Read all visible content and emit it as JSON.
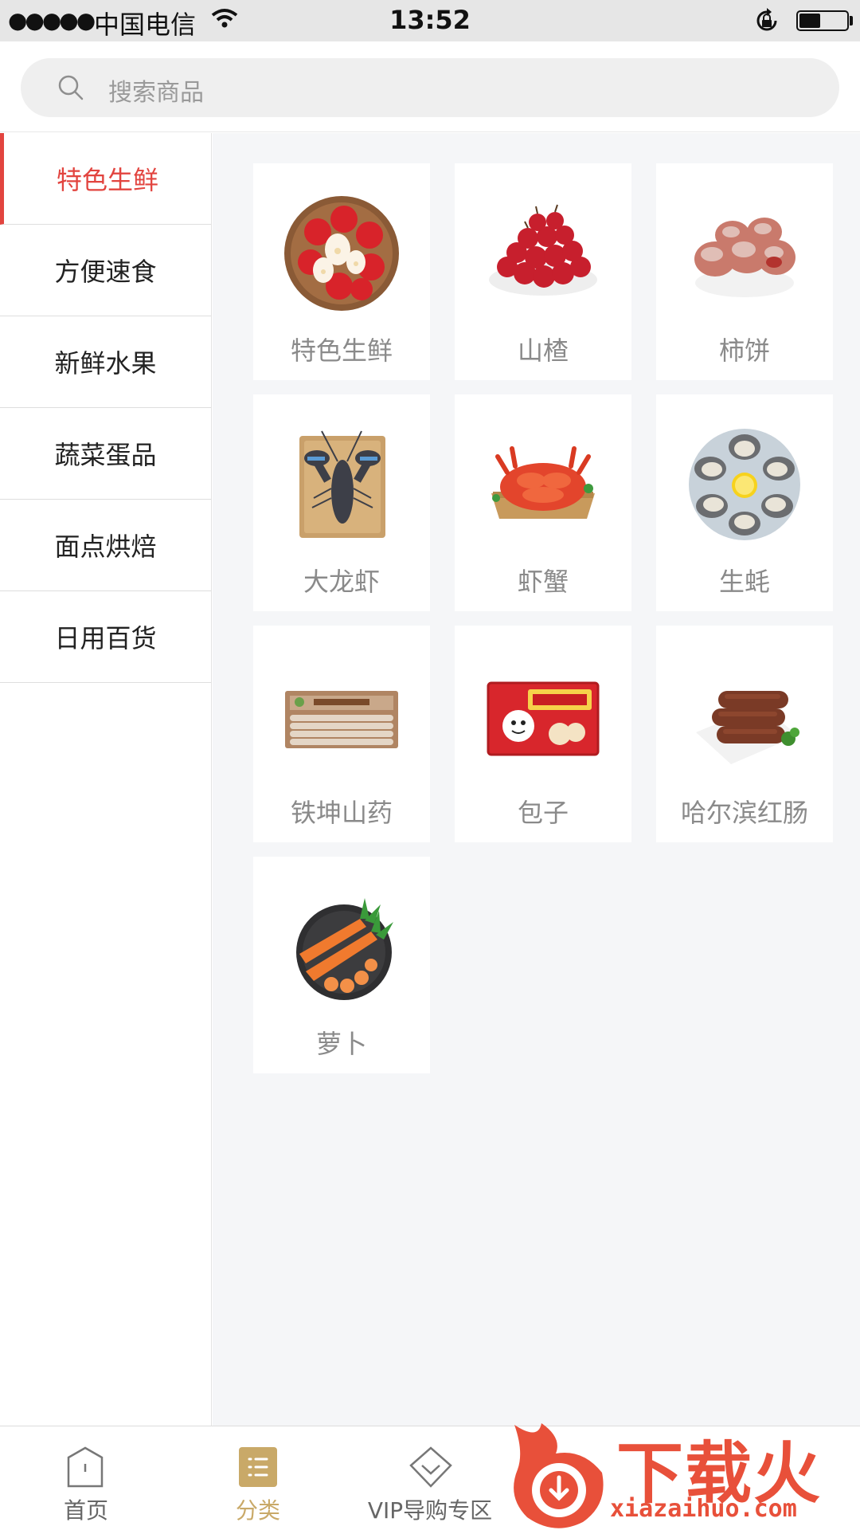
{
  "status_bar": {
    "signal": "●●●●●",
    "carrier": "中国电信",
    "time": "13:52",
    "battery_level": 0.45
  },
  "search": {
    "placeholder": "搜索商品"
  },
  "sidebar": {
    "items": [
      {
        "label": "特色生鲜",
        "active": true
      },
      {
        "label": "方便速食",
        "active": false
      },
      {
        "label": "新鲜水果",
        "active": false
      },
      {
        "label": "蔬菜蛋品",
        "active": false
      },
      {
        "label": "面点烘焙",
        "active": false
      },
      {
        "label": "日用百货",
        "active": false
      }
    ]
  },
  "grid": {
    "items": [
      {
        "label": "特色生鲜",
        "icon": "wax-apple-bowl-image"
      },
      {
        "label": "山楂",
        "icon": "hawthorn-bowl-image"
      },
      {
        "label": "柿饼",
        "icon": "dried-persimmon-image"
      },
      {
        "label": "大龙虾",
        "icon": "lobster-image"
      },
      {
        "label": "虾蟹",
        "icon": "crab-image"
      },
      {
        "label": "生蚝",
        "icon": "oyster-plate-image"
      },
      {
        "label": "铁坤山药",
        "icon": "yam-box-image"
      },
      {
        "label": "包子",
        "icon": "bun-package-image"
      },
      {
        "label": "哈尔滨红肠",
        "icon": "sausage-plate-image"
      },
      {
        "label": "萝卜",
        "icon": "carrot-bowl-image"
      }
    ]
  },
  "tab_bar": {
    "tabs": [
      {
        "label": "首页",
        "icon": "home-icon",
        "active": false
      },
      {
        "label": "分类",
        "icon": "category-icon",
        "active": true
      },
      {
        "label": "VIP导购专区",
        "icon": "diamond-icon",
        "active": false
      }
    ]
  },
  "watermark": {
    "text": "下载火",
    "url": "xiazaihuo.com"
  },
  "colors": {
    "accent": "#e2443f",
    "tab_active": "#c9a968",
    "content_bg": "#f5f6f8"
  }
}
